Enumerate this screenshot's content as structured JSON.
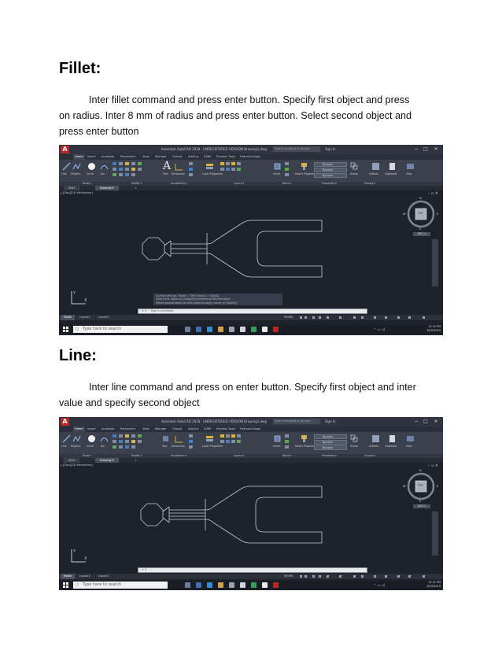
{
  "section1": {
    "heading": "Fillet:",
    "para_line1": "Inter fillet command and press enter button. Specify first object and press",
    "para_line2": "on radius. Inter 8 mm of radius and press enter button. Select second object and",
    "para_line3": "press enter button"
  },
  "section2": {
    "heading": "Line:",
    "para_line1": "Inter line command and press on enter button. Specify first object and inter",
    "para_line2": "value and specify second object"
  },
  "cad": {
    "app_letter": "A",
    "title": "Autodesk AutoCAD 2018 - UNREGISTERED VERSION   Drawing1.dwg",
    "search_placeholder": "Type a keyword or phrase",
    "sign_in": "Sign In",
    "win_min": "−",
    "win_max": "□",
    "win_close": "✕",
    "ribbon_tabs": [
      "Home",
      "Insert",
      "Annotate",
      "Parametric",
      "View",
      "Manage",
      "Output",
      "Add-ins",
      "A360",
      "Express Tools",
      "Featured Apps"
    ],
    "draw_tools": [
      "Line",
      "Polyline",
      "Circle",
      "Arc"
    ],
    "text_tool": "Text",
    "dimension_tool": "Dimension",
    "layer_props": "Layer Properties",
    "insert_tool": "Insert",
    "match_props": "Match Properties",
    "bylayer": "ByLayer",
    "group_tool": "Group",
    "utilities": "Utilities",
    "clipboard": "Clipboard",
    "view_tool": "View",
    "panels": [
      "Draw ▾",
      "Modify ▾",
      "Annotation ▾",
      "Layers ▾",
      "Block ▾",
      "Properties ▾",
      "Groups ▾"
    ],
    "doc_tabs": {
      "start": "Start",
      "drawing": "Drawing1*"
    },
    "view_label": "[-][Top][2D Wireframe]",
    "viewcube": {
      "top": "N",
      "face": "TOP",
      "bottom": "S",
      "left": "W",
      "right": "E",
      "wcs": "WCS ▾"
    },
    "cmd_history1": [
      "Current settings: Mode = TRIM, Radius = 8.0000",
      "Select first object or [Undo/Polyline/Radius/Trim/Multiple]:",
      "Select second object or shift-select to apply corner or [Radius]:"
    ],
    "cmd_prompt1": "Type a command",
    "cmd_prompt2": "",
    "layout_tabs": [
      "Model",
      "Layout1",
      "Layout2"
    ],
    "status_model": "MODEL",
    "taskbar_search": "Type here to search",
    "clock1": {
      "time": "12:10 PM",
      "date": "6/29/2019"
    },
    "clock2": {
      "time": "12:11 PM",
      "date": "6/29/2019"
    }
  },
  "colors": {
    "cad_background": "#1d222b",
    "drawing_lines": "#c9ccd2",
    "autocad_red": "#c8221f"
  }
}
